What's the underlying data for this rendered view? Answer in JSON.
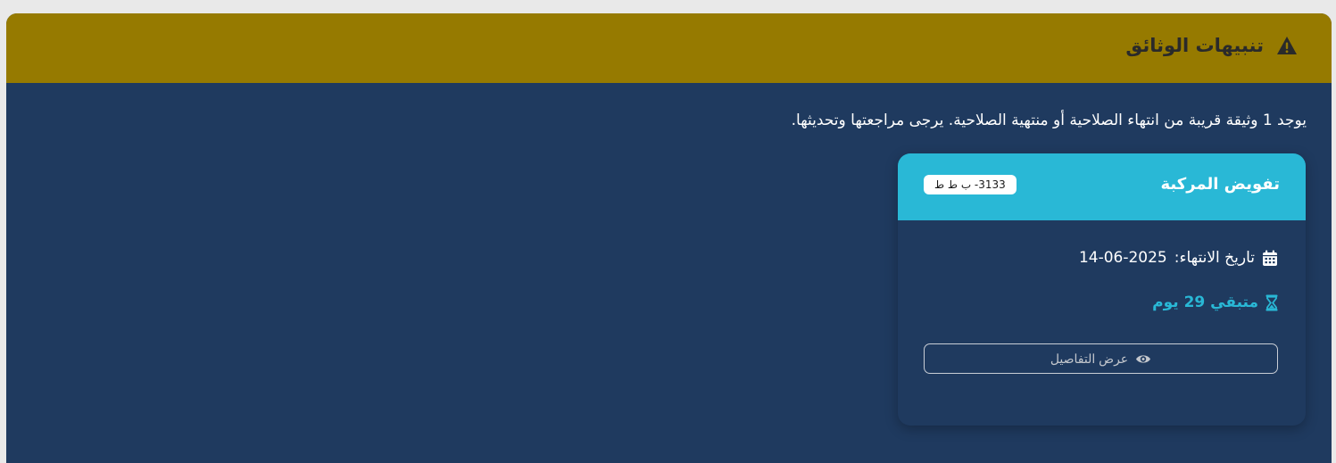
{
  "alert": {
    "title": "تنبيهات الوثائق",
    "icon": "warning-triangle-icon",
    "message": "يوجد 1 وثيقة قريبة من انتهاء الصلاحية أو منتهية الصلاحية. يرجى مراجعتها وتحديثها.",
    "colors": {
      "header_bg": "#967a00",
      "body_bg": "#1f3a5f"
    }
  },
  "card": {
    "title": "تفويض المركبة",
    "plate": "3133- ب ط ط",
    "expiry_label": "تاريخ الانتهاء:",
    "expiry_date": "14-06-2025",
    "expiry_icon": "calendar-icon",
    "remaining_text": "متبقي 29 يوم",
    "remaining_icon": "hourglass-icon",
    "details_button": "عرض التفاصيل",
    "details_icon": "eye-icon",
    "colors": {
      "accent": "#29b8d6"
    }
  }
}
